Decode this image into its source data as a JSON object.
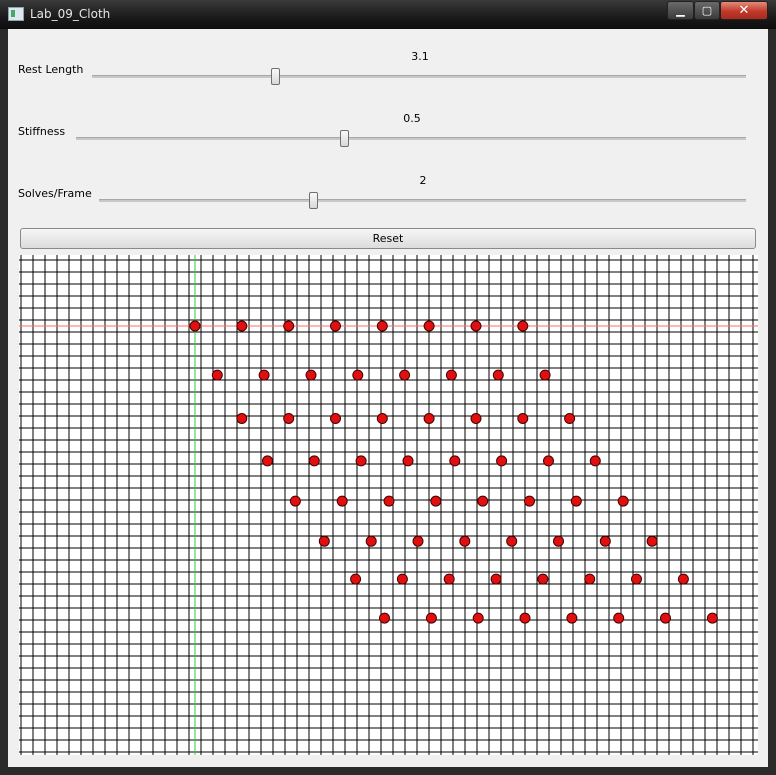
{
  "window": {
    "title": "Lab_09_Cloth"
  },
  "controls": {
    "minimize": "▁",
    "maximize": "▢",
    "close": "✕"
  },
  "sliders": [
    {
      "label": "Rest Length",
      "value": "3.1",
      "position": 0.28
    },
    {
      "label": "Stiffness",
      "value": "0.5",
      "position": 0.4
    },
    {
      "label": "Solves/Frame",
      "value": "2",
      "position": 0.33
    }
  ],
  "reset_label": "Reset",
  "cloth": {
    "grid_step": 12,
    "axis_colors": {
      "x_axis": "#ff6b6b",
      "y_axis": "#2ecc40"
    },
    "point_color": "#e01010",
    "rows": [
      [
        [
          -3,
          3
        ],
        [
          -2.58,
          3
        ],
        [
          -2.16,
          3
        ],
        [
          -1.74,
          3
        ],
        [
          -1.32,
          3
        ],
        [
          -0.9,
          3
        ],
        [
          -0.48,
          3
        ],
        [
          -0.06,
          3
        ]
      ],
      [
        [
          -2.8,
          2.56
        ],
        [
          -2.38,
          2.56
        ],
        [
          -1.96,
          2.56
        ],
        [
          -1.54,
          2.56
        ],
        [
          -1.12,
          2.56
        ],
        [
          -0.7,
          2.56
        ],
        [
          -0.28,
          2.56
        ],
        [
          0.14,
          2.56
        ]
      ],
      [
        [
          -2.58,
          2.17
        ],
        [
          -2.16,
          2.17
        ],
        [
          -1.74,
          2.17
        ],
        [
          -1.32,
          2.17
        ],
        [
          -0.9,
          2.17
        ],
        [
          -0.48,
          2.17
        ],
        [
          -0.06,
          2.17
        ],
        [
          0.36,
          2.17
        ]
      ],
      [
        [
          -2.35,
          1.79
        ],
        [
          -1.93,
          1.79
        ],
        [
          -1.51,
          1.79
        ],
        [
          -1.09,
          1.79
        ],
        [
          -0.67,
          1.79
        ],
        [
          -0.25,
          1.79
        ],
        [
          0.17,
          1.79
        ],
        [
          0.59,
          1.79
        ]
      ],
      [
        [
          -2.1,
          1.43
        ],
        [
          -1.68,
          1.43
        ],
        [
          -1.26,
          1.43
        ],
        [
          -0.84,
          1.43
        ],
        [
          -0.42,
          1.43
        ],
        [
          0.0,
          1.43
        ],
        [
          0.42,
          1.43
        ],
        [
          0.84,
          1.43
        ]
      ],
      [
        [
          -1.84,
          1.07
        ],
        [
          -1.42,
          1.07
        ],
        [
          -1.0,
          1.07
        ],
        [
          -0.58,
          1.07
        ],
        [
          -0.16,
          1.07
        ],
        [
          0.26,
          1.07
        ],
        [
          0.68,
          1.07
        ],
        [
          1.1,
          1.07
        ]
      ],
      [
        [
          -1.56,
          0.73
        ],
        [
          -1.14,
          0.73
        ],
        [
          -0.72,
          0.73
        ],
        [
          -0.3,
          0.73
        ],
        [
          0.12,
          0.73
        ],
        [
          0.54,
          0.73
        ],
        [
          0.96,
          0.73
        ],
        [
          1.38,
          0.73
        ]
      ],
      [
        [
          -1.3,
          0.38
        ],
        [
          -0.88,
          0.38
        ],
        [
          -0.46,
          0.38
        ],
        [
          -0.04,
          0.38
        ],
        [
          0.38,
          0.38
        ],
        [
          0.8,
          0.38
        ],
        [
          1.22,
          0.38
        ],
        [
          1.64,
          0.38
        ]
      ]
    ]
  }
}
